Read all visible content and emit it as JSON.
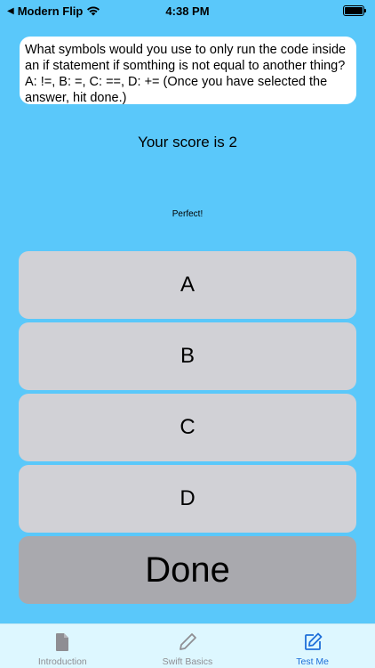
{
  "status_bar": {
    "back_app": "Modern Flip",
    "time": "4:38 PM"
  },
  "question": {
    "text": "What symbols would you use to only run the code inside an if statement if somthing is not equal to another thing? A: !=, B: =, C: ==, D: += (Once you have selected the answer, hit done.)"
  },
  "score": {
    "text": "Your score is 2"
  },
  "feedback": {
    "text": "Perfect!"
  },
  "answers": [
    {
      "label": "A"
    },
    {
      "label": "B"
    },
    {
      "label": "C"
    },
    {
      "label": "D"
    }
  ],
  "done": {
    "label": "Done"
  },
  "tabs": [
    {
      "label": "Introduction",
      "icon": "document-icon"
    },
    {
      "label": "Swift Basics",
      "icon": "pencil-icon"
    },
    {
      "label": "Test Me",
      "icon": "compose-icon"
    }
  ],
  "colors": {
    "background": "#5AC8FA",
    "button": "#D1D1D6",
    "done_button": "#A9A9AE",
    "tab_active": "#1E6FD9",
    "tab_inactive": "#8E8E93"
  }
}
